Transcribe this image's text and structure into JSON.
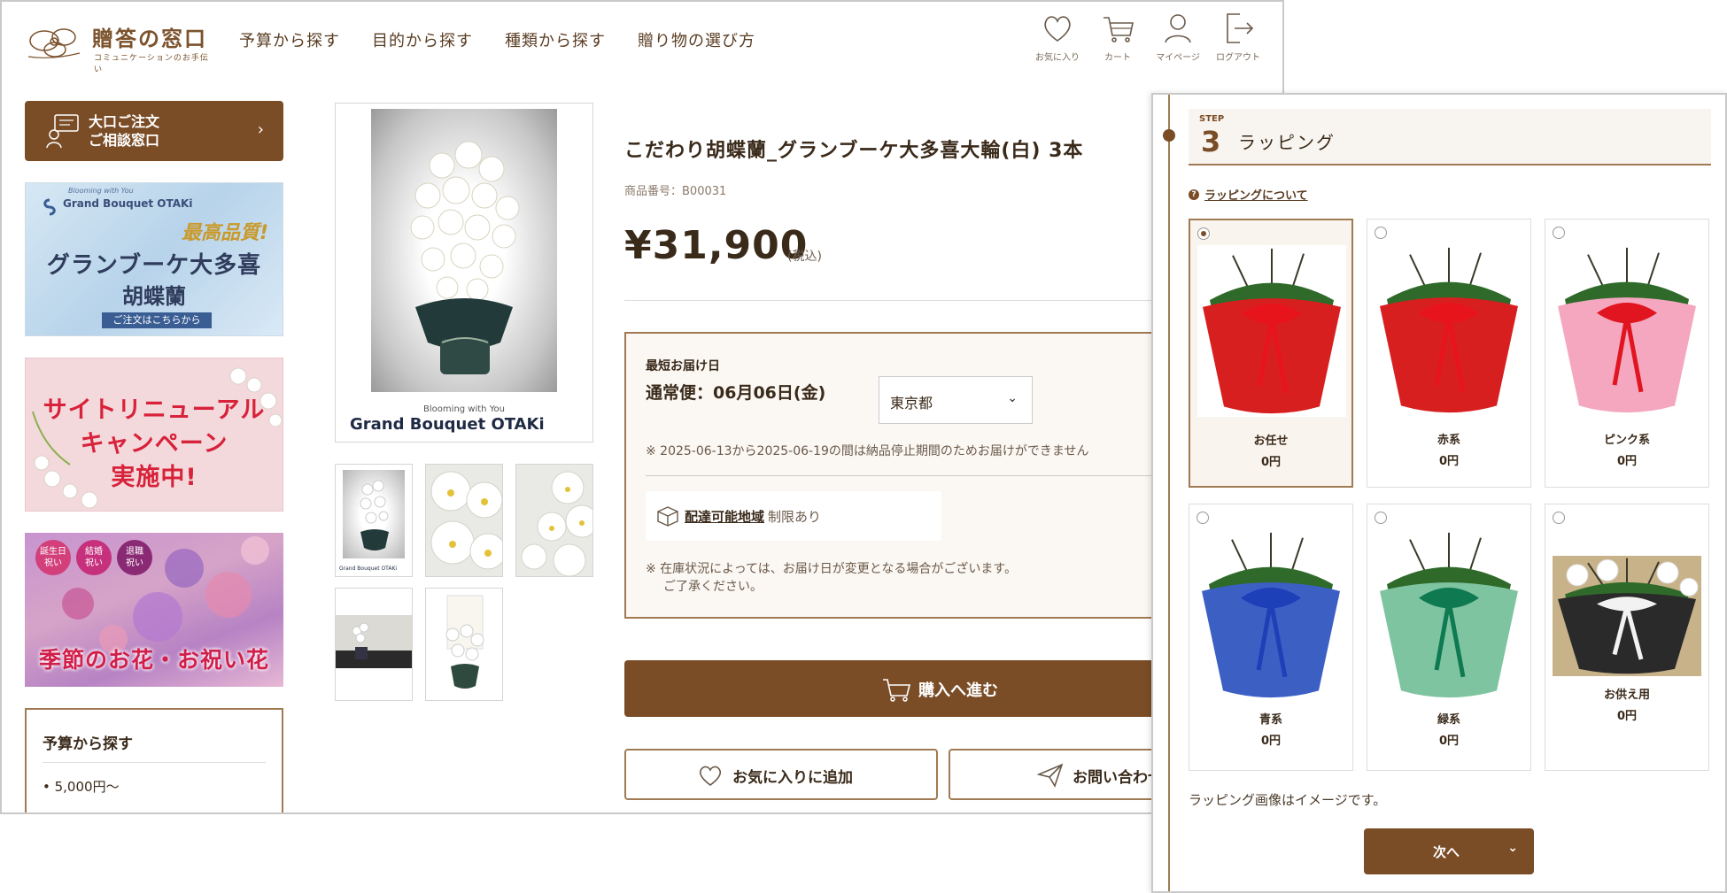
{
  "header": {
    "logo_title": "贈答の窓口",
    "logo_subtitle": "コミュニケーションのお手伝い",
    "nav": [
      "予算から探す",
      "目的から探す",
      "種類から探す",
      "贈り物の選び方"
    ],
    "icons": [
      {
        "icon": "heart-icon",
        "label": "お気に入り"
      },
      {
        "icon": "cart-icon",
        "label": "カート"
      },
      {
        "icon": "user-icon",
        "label": "マイページ"
      },
      {
        "icon": "logout-icon",
        "label": "ログアウト"
      }
    ]
  },
  "sidebar": {
    "bulk_line1": "大口ご注文",
    "bulk_line2": "ご相談窓口",
    "banner_grand": {
      "brand_top": "Blooming with You",
      "brand": "Grand Bouquet OTAKi",
      "badge": "最高品質!",
      "line1": "グランブーケ大多喜",
      "line2": "胡蝶蘭",
      "cta": "ご注文はこちらから"
    },
    "banner_renewal": {
      "line1": "サイトリニューアル",
      "line2": "キャンペーン",
      "line3": "実施中!"
    },
    "banner_seasonal": {
      "tags": [
        [
          "誕生日",
          "祝い"
        ],
        [
          "結婚",
          "祝い"
        ],
        [
          "退職",
          "祝い"
        ]
      ],
      "title": "季節のお花・お祝い花"
    },
    "budget": {
      "heading": "予算から探す",
      "first_item": "5,000円〜"
    }
  },
  "product": {
    "image_caption1": "Blooming with You",
    "image_caption2": "Grand Bouquet OTAKi",
    "thumb_caption": "Grand Bouquet OTAKi",
    "title": "こだわり胡蝶蘭_グランブーケ大多喜大輪(白) 3本",
    "code": "商品番号：B00031",
    "price": "¥31,900",
    "tax": "(税込)"
  },
  "delivery": {
    "label": "最短お届け日",
    "date": "通常便：06月06日(金)",
    "prefecture": "東京都",
    "stop_note": "※ 2025-06-13から2025-06-19の間は納品停止期間のためお届けができません",
    "region_link": "配達可能地域",
    "region_rest": "制限あり",
    "stock_note_1": "※ 在庫状況によっては、お届け日が変更となる場合がございます。",
    "stock_note_2": "ご了承ください。"
  },
  "actions": {
    "purchase": "購入へ進む",
    "favorite": "お気に入りに追加",
    "inquiry": "お問い合わせ"
  },
  "wrapping": {
    "step_label": "STEP",
    "step_num": "3",
    "step_title": "ラッピング",
    "about_link": "ラッピングについて",
    "options": [
      {
        "name": "お任せ",
        "price": "0円",
        "selected": true,
        "paper": "#d81f1f",
        "ribbon": "#e8141c",
        "bg": "#ffffff"
      },
      {
        "name": "赤系",
        "price": "0円",
        "selected": false,
        "paper": "#d81f1f",
        "ribbon": "#e8141c",
        "bg": "#ffffff"
      },
      {
        "name": "ピンク系",
        "price": "0円",
        "selected": false,
        "paper": "#f4a7bf",
        "ribbon": "#e0151f",
        "bg": "#ffffff"
      },
      {
        "name": "青系",
        "price": "0円",
        "selected": false,
        "paper": "#3c5fc4",
        "ribbon": "#1d3fb8",
        "bg": "#ffffff"
      },
      {
        "name": "緑系",
        "price": "0円",
        "selected": false,
        "paper": "#7fc4a0",
        "ribbon": "#0f7a52",
        "bg": "#ffffff"
      },
      {
        "name": "お供え用",
        "price": "0円",
        "selected": false,
        "paper": "#2a2a2a",
        "ribbon": "#f2f2f2",
        "bg": "#c8b28a"
      }
    ],
    "image_note": "ラッピング画像はイメージです。",
    "next": "次へ"
  },
  "colors": {
    "brand_brown": "#7b4d27",
    "border_brown": "#a07a52"
  }
}
